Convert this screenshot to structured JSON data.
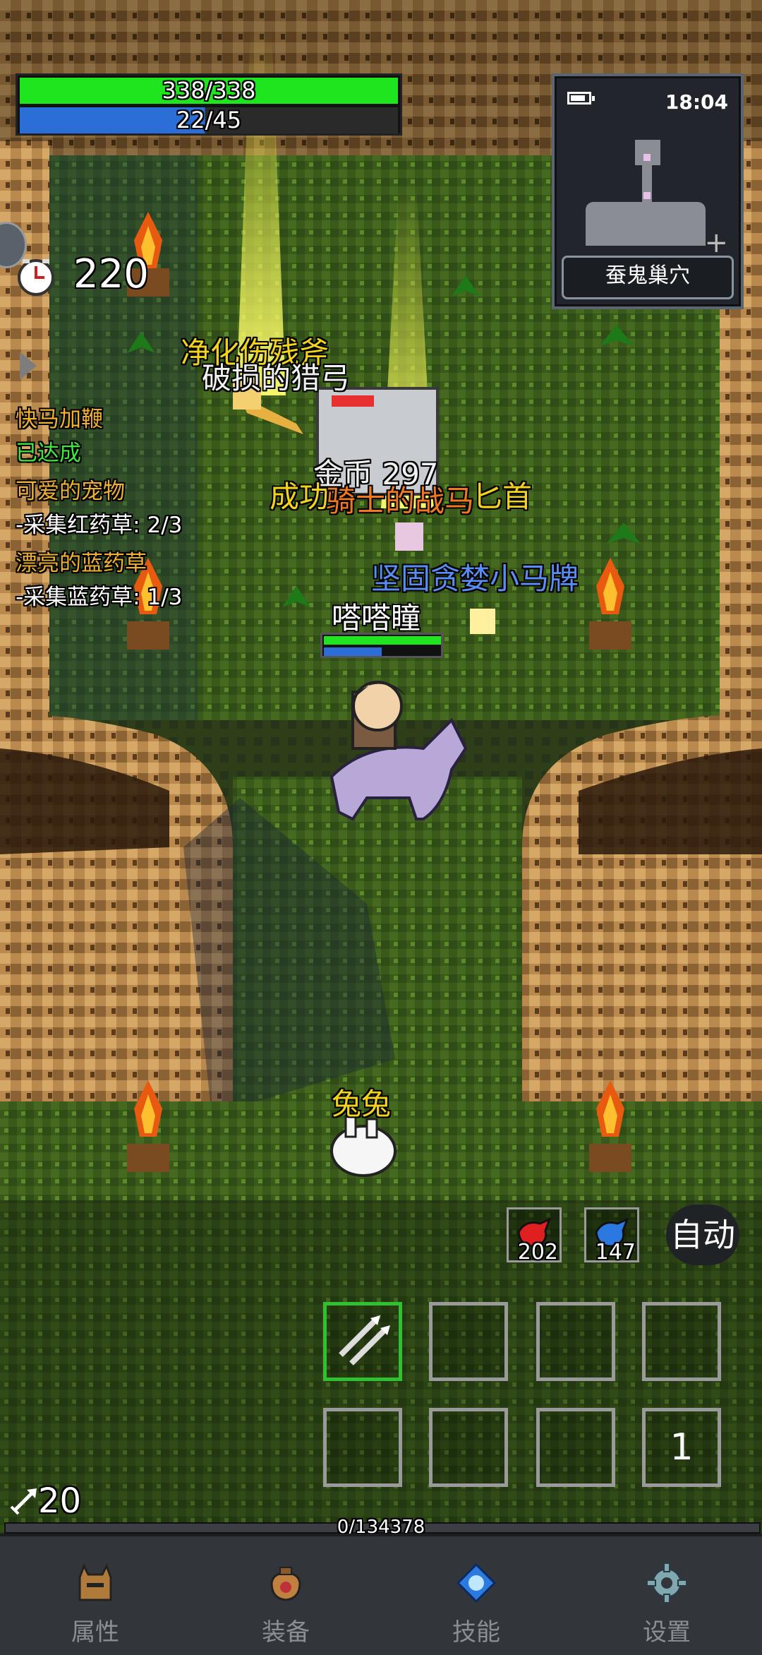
{
  "hud": {
    "hp_text": "338/338",
    "hp_fraction": 1.0,
    "mp_text": "22/45",
    "mp_fraction": 0.49,
    "timer_value": "220",
    "arrow_count": "20"
  },
  "minimap": {
    "time": "18:04",
    "location": "蚕鬼巢穴"
  },
  "quests": [
    {
      "title": "快马加鞭",
      "status": "已达成"
    },
    {
      "title": "可爱的宠物",
      "status": "-采集红药草: 2/3"
    },
    {
      "title": "漂亮的蓝药草",
      "status": "-采集蓝药草: 1/3"
    }
  ],
  "floating_texts": {
    "drop_1": "净化伤残斧",
    "drop_2": "破损的猎弓",
    "gold": "金币 297",
    "success": "成功",
    "drop_3": "骑士的战马",
    "drop_3_suffix": "匕首",
    "drop_4": "坚固贪婪小马牌",
    "player_name": "嗒嗒瞳",
    "pet_name": "兔兔"
  },
  "potions": {
    "red_count": "202",
    "blue_count": "147"
  },
  "auto_button": "自动",
  "skill_page": "1",
  "xp_text": "0/134378",
  "nav": {
    "attributes": "属性",
    "equipment": "装备",
    "skills": "技能",
    "settings": "设置"
  },
  "colors": {
    "hp": "#1fe51f",
    "mp": "#2c6ed8",
    "quest_title": "#f0b030",
    "quest_done": "#3ee63e",
    "drop_gold": "#f3d21a",
    "drop_blue": "#5a8cf5"
  }
}
